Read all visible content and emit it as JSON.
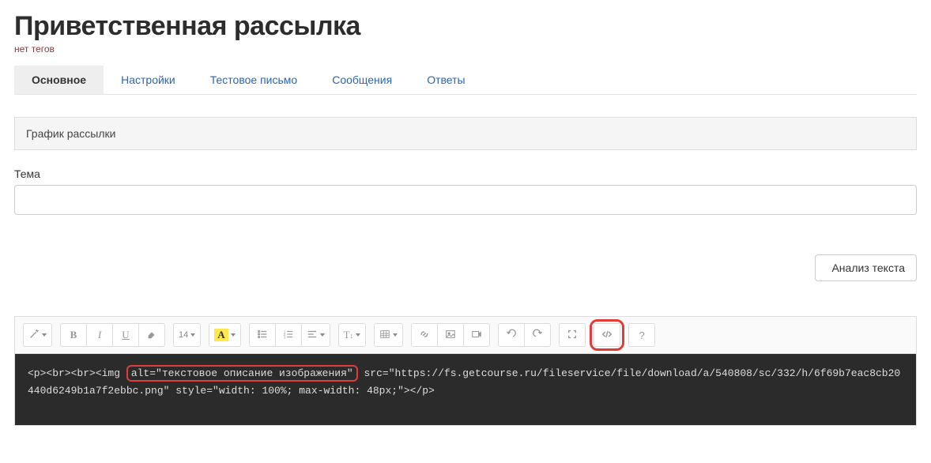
{
  "header": {
    "title": "Приветственная рассылка",
    "no_tags": "нет тегов"
  },
  "tabs": [
    {
      "label": "Основное",
      "active": true
    },
    {
      "label": "Настройки",
      "active": false
    },
    {
      "label": "Тестовое письмо",
      "active": false
    },
    {
      "label": "Сообщения",
      "active": false
    },
    {
      "label": "Ответы",
      "active": false
    }
  ],
  "schedule_panel": {
    "title": "График рассылки"
  },
  "subject": {
    "label": "Тема",
    "value": ""
  },
  "analyze_button": "Анализ текста",
  "toolbar": {
    "fontsize_label": "14"
  },
  "code": {
    "pre": "<p><br><br><img ",
    "highlight": "alt=\"текстовое описание изображения\"",
    "post": " src=\"https://fs.getcourse.ru/fileservice/file/download/a/540808/sc/332/h/6f69b7eac8cb20440d6249b1a7f2ebbc.png\" style=\"width: 100%; max-width: 48px;\"></p>"
  }
}
